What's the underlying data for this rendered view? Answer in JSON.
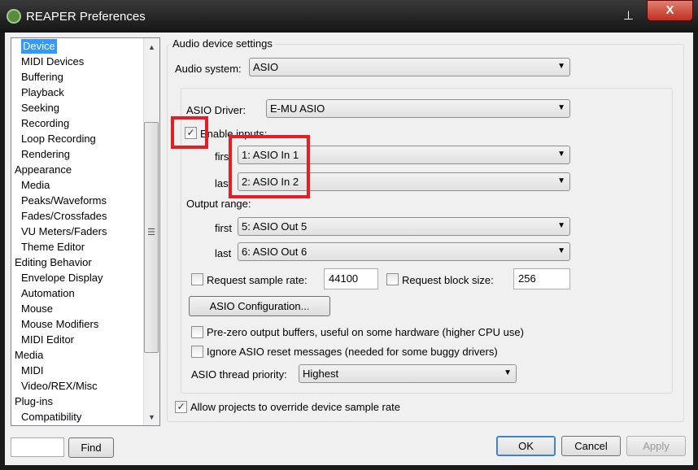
{
  "window": {
    "title": "REAPER Preferences",
    "pin": "⊥",
    "close": "X"
  },
  "sidebar": {
    "items": [
      {
        "label": "Device",
        "level": 1,
        "selected": true
      },
      {
        "label": "MIDI Devices",
        "level": 1
      },
      {
        "label": "Buffering",
        "level": 1
      },
      {
        "label": "Playback",
        "level": 1
      },
      {
        "label": "Seeking",
        "level": 1
      },
      {
        "label": "Recording",
        "level": 1
      },
      {
        "label": "Loop Recording",
        "level": 1
      },
      {
        "label": "Rendering",
        "level": 1
      },
      {
        "label": "Appearance",
        "level": 0
      },
      {
        "label": "Media",
        "level": 1
      },
      {
        "label": "Peaks/Waveforms",
        "level": 1
      },
      {
        "label": "Fades/Crossfades",
        "level": 1
      },
      {
        "label": "VU Meters/Faders",
        "level": 1
      },
      {
        "label": "Theme Editor",
        "level": 1
      },
      {
        "label": "Editing Behavior",
        "level": 0
      },
      {
        "label": "Envelope Display",
        "level": 1
      },
      {
        "label": "Automation",
        "level": 1
      },
      {
        "label": "Mouse",
        "level": 1
      },
      {
        "label": "Mouse Modifiers",
        "level": 1
      },
      {
        "label": "MIDI Editor",
        "level": 1
      },
      {
        "label": "Media",
        "level": 0
      },
      {
        "label": "MIDI",
        "level": 1
      },
      {
        "label": "Video/REX/Misc",
        "level": 1
      },
      {
        "label": "Plug-ins",
        "level": 0
      },
      {
        "label": "Compatibility",
        "level": 1
      }
    ],
    "find_value": "",
    "find_label": "Find"
  },
  "settings": {
    "group_title": "Audio device settings",
    "audio_system_label": "Audio system:",
    "audio_system": "ASIO",
    "asio_driver_label": "ASIO Driver:",
    "asio_driver": "E-MU ASIO",
    "enable_inputs_label": "Enable inputs:",
    "enable_inputs": true,
    "input_first_label": "first",
    "input_first": "1: ASIO In 1",
    "input_last_label": "last",
    "input_last": "2: ASIO In 2",
    "output_range_label": "Output range:",
    "output_first_label": "first",
    "output_first": "5: ASIO Out 5",
    "output_last_label": "last",
    "output_last": "6: ASIO Out 6",
    "request_rate_label": "Request sample rate:",
    "request_rate_checked": false,
    "sample_rate": "44100",
    "request_block_label": "Request block size:",
    "request_block_checked": false,
    "block_size": "256",
    "asio_config_label": "ASIO Configuration...",
    "prezero_label": "Pre-zero output buffers, useful on some hardware (higher CPU use)",
    "prezero_checked": false,
    "ignore_reset_label": "Ignore ASIO reset messages (needed for some buggy drivers)",
    "ignore_reset_checked": false,
    "thread_priority_label": "ASIO thread priority:",
    "thread_priority": "Highest",
    "allow_override_label": "Allow projects to override device sample rate",
    "allow_override_checked": true
  },
  "buttons": {
    "ok": "OK",
    "cancel": "Cancel",
    "apply": "Apply"
  },
  "check_glyph": "✓"
}
